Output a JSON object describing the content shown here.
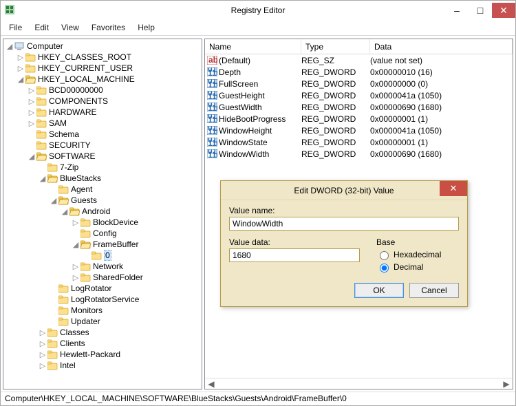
{
  "window": {
    "title": "Registry Editor"
  },
  "menu": {
    "file": "File",
    "edit": "Edit",
    "view": "View",
    "favorites": "Favorites",
    "help": "Help"
  },
  "tree": {
    "root": "Computer",
    "hkcr": "HKEY_CLASSES_ROOT",
    "hkcu": "HKEY_CURRENT_USER",
    "hklm": "HKEY_LOCAL_MACHINE",
    "bcd": "BCD00000000",
    "components": "COMPONENTS",
    "hardware": "HARDWARE",
    "sam": "SAM",
    "schema": "Schema",
    "security": "SECURITY",
    "software": "SOFTWARE",
    "sevenzip": "7-Zip",
    "bluestacks": "BlueStacks",
    "agent": "Agent",
    "guests": "Guests",
    "android": "Android",
    "blockdevice": "BlockDevice",
    "config": "Config",
    "framebuffer": "FrameBuffer",
    "zero": "0",
    "network": "Network",
    "sharedfolder": "SharedFolder",
    "logrotator": "LogRotator",
    "logrotatorservice": "LogRotatorService",
    "monitors": "Monitors",
    "updater": "Updater",
    "classes": "Classes",
    "clients": "Clients",
    "hp": "Hewlett-Packard",
    "intel": "Intel"
  },
  "columns": {
    "name": "Name",
    "type": "Type",
    "data": "Data"
  },
  "values": [
    {
      "icon": "sz",
      "name": "(Default)",
      "type": "REG_SZ",
      "data": "(value not set)"
    },
    {
      "icon": "dw",
      "name": "Depth",
      "type": "REG_DWORD",
      "data": "0x00000010 (16)"
    },
    {
      "icon": "dw",
      "name": "FullScreen",
      "type": "REG_DWORD",
      "data": "0x00000000 (0)"
    },
    {
      "icon": "dw",
      "name": "GuestHeight",
      "type": "REG_DWORD",
      "data": "0x0000041a (1050)"
    },
    {
      "icon": "dw",
      "name": "GuestWidth",
      "type": "REG_DWORD",
      "data": "0x00000690 (1680)"
    },
    {
      "icon": "dw",
      "name": "HideBootProgress",
      "type": "REG_DWORD",
      "data": "0x00000001 (1)"
    },
    {
      "icon": "dw",
      "name": "WindowHeight",
      "type": "REG_DWORD",
      "data": "0x0000041a (1050)"
    },
    {
      "icon": "dw",
      "name": "WindowState",
      "type": "REG_DWORD",
      "data": "0x00000001 (1)"
    },
    {
      "icon": "dw",
      "name": "WindowWidth",
      "type": "REG_DWORD",
      "data": "0x00000690 (1680)"
    }
  ],
  "dialog": {
    "title": "Edit DWORD (32-bit) Value",
    "value_name_label": "Value name:",
    "value_name": "WindowWidth",
    "value_data_label": "Value data:",
    "value_data": "1680",
    "base_label": "Base",
    "hex_label": "Hexadecimal",
    "dec_label": "Decimal",
    "base_selected": "decimal",
    "ok": "OK",
    "cancel": "Cancel"
  },
  "status": "Computer\\HKEY_LOCAL_MACHINE\\SOFTWARE\\BlueStacks\\Guests\\Android\\FrameBuffer\\0"
}
